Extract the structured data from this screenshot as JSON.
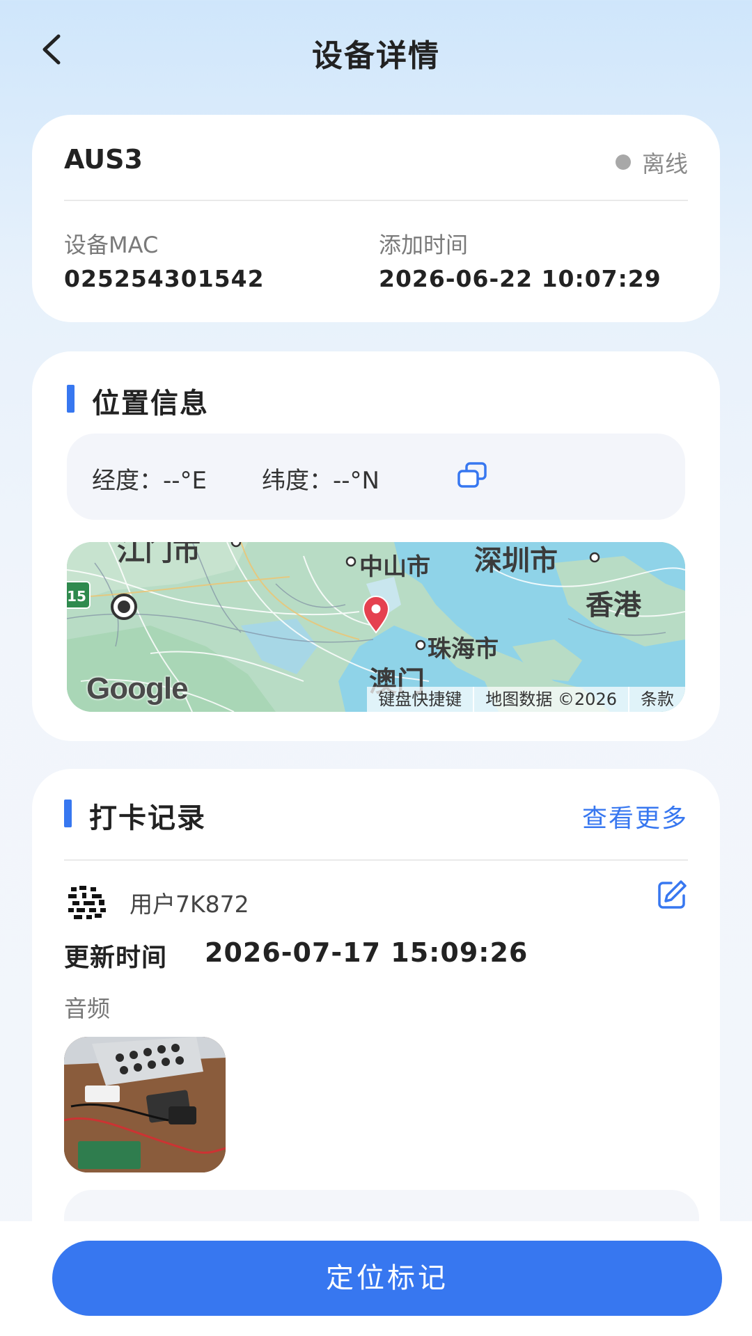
{
  "header": {
    "title": "设备详情"
  },
  "device": {
    "name": "AUS3",
    "status": "离线",
    "status_color": "#a8a8a8",
    "mac_label": "设备MAC",
    "mac_value": "025254301542",
    "added_label": "添加时间",
    "added_value": "2026-06-22 10:07:29"
  },
  "location": {
    "section_title": "位置信息",
    "longitude": "经度：--°E",
    "latitude": "纬度：--°N",
    "map": {
      "labels": {
        "jiangmen": "江门市",
        "zhongshan": "中山市",
        "shenzhen": "深圳市",
        "hongkong": "香港",
        "zhuhai": "珠海市",
        "macau": "澳门",
        "route_shield": "15"
      },
      "logo": "Google",
      "footer": {
        "shortcuts": "键盘快捷键",
        "data": "地图数据 ©2026",
        "terms": "条款"
      }
    }
  },
  "records": {
    "section_title": "打卡记录",
    "more_label": "查看更多",
    "items": [
      {
        "user": "用户7K872",
        "update_label": "更新时间",
        "update_value": "2026-07-17 15:09:26",
        "media_label": "音频"
      }
    ]
  },
  "footer": {
    "button_label": "定位标记"
  },
  "colors": {
    "accent": "#3777f0",
    "offline": "#a8a8a8",
    "pin": "#e5414f"
  }
}
